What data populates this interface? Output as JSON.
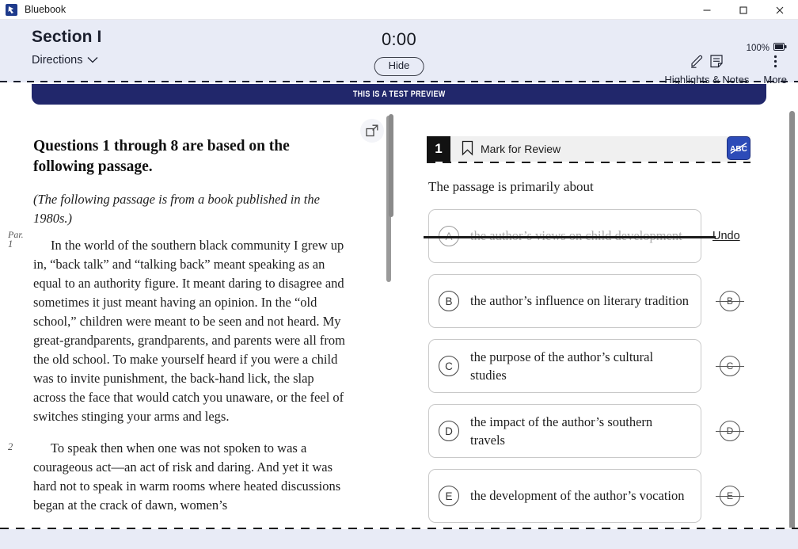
{
  "window": {
    "app_title": "Bluebook",
    "logo_icon": "bluebook-logo-icon",
    "minimize_label": "–",
    "maximize_label": "□",
    "close_label": "✕"
  },
  "header": {
    "section_title": "Section I",
    "directions_label": "Directions",
    "directions_chevron_icon": "chevron-down-icon",
    "timer": "0:00",
    "hide_label": "Hide",
    "battery_percent": "100%",
    "battery_icon": "battery-icon",
    "highlights_label": "Highlights & Notes",
    "highlight_icon": "highlighter-pen-icon",
    "notes_icon": "note-icon",
    "more_label": "More",
    "more_icon": "vertical-ellipsis-icon"
  },
  "banner": {
    "text": "THIS IS A TEST PREVIEW"
  },
  "panels": {
    "expand_left_icon": "expand-panel-icon",
    "expand_right_icon": "collapse-panel-icon"
  },
  "passage": {
    "heading": "Questions 1 through 8 are based on the following passage.",
    "note": "(The following passage is from a book published in the 1980s.)",
    "par_label": "Par.",
    "paragraphs": [
      {
        "number": "1",
        "text": "In the world of the southern black community I grew up in, “back talk” and “talking back” meant speaking as an equal to an authority figure. It meant daring to disagree and sometimes it just meant having an opinion. In the “old school,” children were meant to be seen and not heard. My great-grandparents, grandparents, and parents were all from the old school. To make yourself heard if you were a child was to invite punishment, the back-hand lick, the slap across the face that would catch you unaware, or the feel of switches stinging your arms and legs."
      },
      {
        "number": "2",
        "text": "To speak then when one was not spoken to was a courageous act—an act of risk and daring. And yet it was hard not to speak in warm rooms where heated discussions began at the crack of dawn, women’s"
      }
    ]
  },
  "question": {
    "number": "1",
    "bookmark_icon": "bookmark-icon",
    "mark_for_review_label": "Mark for Review",
    "abc_strikethrough_icon": "abc-strikethrough-icon",
    "stem": "The passage is primarily about",
    "undo_label": "Undo",
    "choices": [
      {
        "letter": "A",
        "text": "the author’s views on child development",
        "eliminated": true
      },
      {
        "letter": "B",
        "text": "the author’s influence on literary tradition",
        "eliminated": false
      },
      {
        "letter": "C",
        "text": "the purpose of the author’s cultural studies",
        "eliminated": false
      },
      {
        "letter": "D",
        "text": "the impact of the author’s southern travels",
        "eliminated": false
      },
      {
        "letter": "E",
        "text": "the development of the author’s vocation",
        "eliminated": false
      }
    ]
  },
  "colors": {
    "header_bg": "#e8ebf6",
    "banner_bg": "#21276b",
    "abc_button": "#2c4bb8",
    "question_number_bg": "#121212"
  }
}
